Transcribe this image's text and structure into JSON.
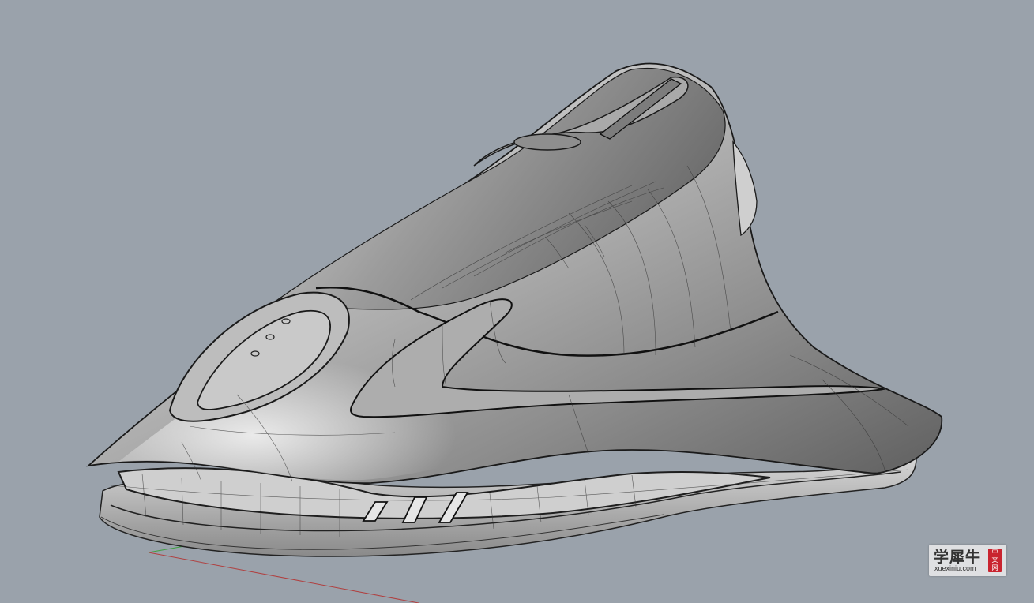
{
  "viewport": {
    "background": "#9aa2ab",
    "render_mode": "shaded-with-isocurves",
    "axis_colors": {
      "x": "#b04040",
      "y": "#3fa040"
    }
  },
  "watermark": {
    "brand_cn": "学犀牛",
    "site": "xuexiniu.com",
    "seal_chars": [
      "中",
      "文",
      "网"
    ]
  }
}
